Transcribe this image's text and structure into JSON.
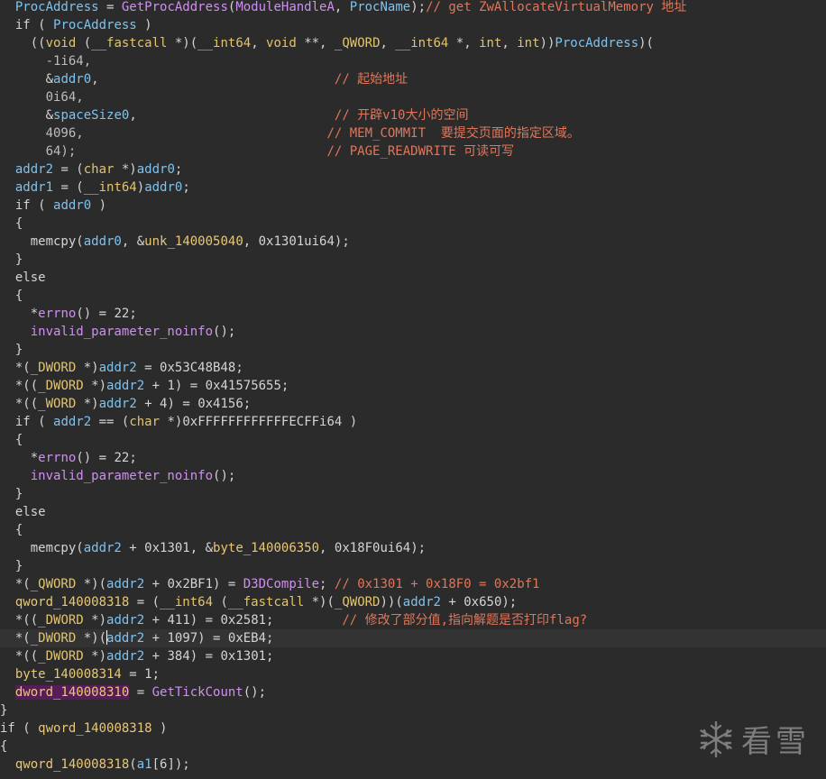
{
  "colors": {
    "background": "#2b2b2b",
    "identifier": "#7ec3ef",
    "function": "#cf8ff0",
    "type_keyword": "#e3c46b",
    "comment": "#e0765a",
    "text": "#d4d4d4"
  },
  "code": {
    "lines": [
      [
        [
          "  ",
          "t-pad"
        ],
        [
          "ProcAddress",
          "t-var"
        ],
        [
          " = ",
          "t-plain"
        ],
        [
          "GetProcAddress",
          "t-fn"
        ],
        [
          "(",
          "t-plain"
        ],
        [
          "ModuleHandleA",
          "t-fn"
        ],
        [
          ", ",
          "t-plain"
        ],
        [
          "ProcName",
          "t-var"
        ],
        [
          ");",
          "t-plain"
        ],
        [
          "// get ZwAllocateVirtualMemory 地址",
          "t-cm"
        ]
      ],
      [
        [
          "  if ( ",
          "t-plain"
        ],
        [
          "ProcAddress",
          "t-var"
        ],
        [
          " )",
          "t-plain"
        ]
      ],
      [
        [
          "    ((",
          "t-plain"
        ],
        [
          "void",
          "t-kw"
        ],
        [
          " (",
          "t-plain"
        ],
        [
          "__fastcall",
          "t-kw"
        ],
        [
          " *)(",
          "t-plain"
        ],
        [
          "__int64",
          "t-kw"
        ],
        [
          ", ",
          "t-plain"
        ],
        [
          "void",
          "t-kw"
        ],
        [
          " **, ",
          "t-plain"
        ],
        [
          "_QWORD",
          "t-kw"
        ],
        [
          ", ",
          "t-plain"
        ],
        [
          "__int64",
          "t-kw"
        ],
        [
          " *, ",
          "t-plain"
        ],
        [
          "int",
          "t-kw"
        ],
        [
          ", ",
          "t-plain"
        ],
        [
          "int",
          "t-kw"
        ],
        [
          "))",
          "t-plain"
        ],
        [
          "ProcAddress",
          "t-var"
        ],
        [
          ")(",
          "t-plain"
        ]
      ],
      [
        [
          "      -1i64,",
          "t-num"
        ]
      ],
      [
        [
          "      &",
          "t-plain"
        ],
        [
          "addr0",
          "t-var"
        ],
        [
          ",                               ",
          "t-plain"
        ],
        [
          "// 起始地址",
          "t-cm"
        ]
      ],
      [
        [
          "      0i64,",
          "t-num"
        ]
      ],
      [
        [
          "      &",
          "t-plain"
        ],
        [
          "spaceSize0",
          "t-var"
        ],
        [
          ",                          ",
          "t-plain"
        ],
        [
          "// 开辟v10大小的空间",
          "t-cm"
        ]
      ],
      [
        [
          "      4096,                                ",
          "t-num"
        ],
        [
          "// MEM_COMMIT  要提交页面的指定区域。",
          "t-cm"
        ]
      ],
      [
        [
          "      64);                                 ",
          "t-num"
        ],
        [
          "// PAGE_READWRITE 可读可写",
          "t-cm"
        ]
      ],
      [
        [
          "  ",
          "t-pad"
        ],
        [
          "addr2",
          "t-var"
        ],
        [
          " = (",
          "t-plain"
        ],
        [
          "char",
          "t-kw"
        ],
        [
          " *)",
          "t-plain"
        ],
        [
          "addr0",
          "t-var"
        ],
        [
          ";",
          "t-plain"
        ]
      ],
      [
        [
          "  ",
          "t-pad"
        ],
        [
          "addr1",
          "t-var"
        ],
        [
          " = (",
          "t-plain"
        ],
        [
          "__int64",
          "t-kw"
        ],
        [
          ")",
          "t-plain"
        ],
        [
          "addr0",
          "t-var"
        ],
        [
          ";",
          "t-plain"
        ]
      ],
      [
        [
          "  if ( ",
          "t-plain"
        ],
        [
          "addr0",
          "t-var"
        ],
        [
          " )",
          "t-plain"
        ]
      ],
      [
        [
          "  {",
          "t-plain"
        ]
      ],
      [
        [
          "    memcpy(",
          "t-plain"
        ],
        [
          "addr0",
          "t-var"
        ],
        [
          ", &",
          "t-plain"
        ],
        [
          "unk_140005040",
          "t-glob"
        ],
        [
          ", 0x1301ui64);",
          "t-plain"
        ]
      ],
      [
        [
          "  }",
          "t-plain"
        ]
      ],
      [
        [
          "  else",
          "t-plain"
        ]
      ],
      [
        [
          "  {",
          "t-plain"
        ]
      ],
      [
        [
          "    *",
          "t-plain"
        ],
        [
          "errno",
          "t-fn"
        ],
        [
          "() = 22;",
          "t-plain"
        ]
      ],
      [
        [
          "    ",
          "t-pad"
        ],
        [
          "invalid_parameter_noinfo",
          "t-fn"
        ],
        [
          "();",
          "t-plain"
        ]
      ],
      [
        [
          "  }",
          "t-plain"
        ]
      ],
      [
        [
          "  *(",
          "t-plain"
        ],
        [
          "_DWORD",
          "t-kw"
        ],
        [
          " *)",
          "t-plain"
        ],
        [
          "addr2",
          "t-var"
        ],
        [
          " = 0x53C48B48;",
          "t-plain"
        ]
      ],
      [
        [
          "  *((",
          "t-plain"
        ],
        [
          "_DWORD",
          "t-kw"
        ],
        [
          " *)",
          "t-plain"
        ],
        [
          "addr2",
          "t-var"
        ],
        [
          " + 1) = 0x41575655;",
          "t-plain"
        ]
      ],
      [
        [
          "  *((",
          "t-plain"
        ],
        [
          "_WORD",
          "t-kw"
        ],
        [
          " *)",
          "t-plain"
        ],
        [
          "addr2",
          "t-var"
        ],
        [
          " + 4) = 0x4156;",
          "t-plain"
        ]
      ],
      [
        [
          "  if ( ",
          "t-plain"
        ],
        [
          "addr2",
          "t-var"
        ],
        [
          " == (",
          "t-plain"
        ],
        [
          "char",
          "t-kw"
        ],
        [
          " *)0xFFFFFFFFFFFFECFFi64 )",
          "t-plain"
        ]
      ],
      [
        [
          "  {",
          "t-plain"
        ]
      ],
      [
        [
          "    *",
          "t-plain"
        ],
        [
          "errno",
          "t-fn"
        ],
        [
          "() = 22;",
          "t-plain"
        ]
      ],
      [
        [
          "    ",
          "t-pad"
        ],
        [
          "invalid_parameter_noinfo",
          "t-fn"
        ],
        [
          "();",
          "t-plain"
        ]
      ],
      [
        [
          "  }",
          "t-plain"
        ]
      ],
      [
        [
          "  else",
          "t-plain"
        ]
      ],
      [
        [
          "  {",
          "t-plain"
        ]
      ],
      [
        [
          "    memcpy(",
          "t-plain"
        ],
        [
          "addr2",
          "t-var"
        ],
        [
          " + 0x1301, &",
          "t-plain"
        ],
        [
          "byte_140006350",
          "t-glob"
        ],
        [
          ", 0x18F0ui64);",
          "t-plain"
        ]
      ],
      [
        [
          "  }",
          "t-plain"
        ]
      ],
      [
        [
          "  *(",
          "t-plain"
        ],
        [
          "_QWORD",
          "t-kw"
        ],
        [
          " *)(",
          "t-plain"
        ],
        [
          "addr2",
          "t-var"
        ],
        [
          " + 0x2BF1) = ",
          "t-plain"
        ],
        [
          "D3DCompile",
          "t-fn"
        ],
        [
          "; ",
          "t-plain"
        ],
        [
          "// 0x1301 + 0x18F0 = 0x2bf1",
          "t-cm"
        ]
      ],
      [
        [
          "  ",
          "t-pad"
        ],
        [
          "qword_140008318",
          "t-glob"
        ],
        [
          " = (",
          "t-plain"
        ],
        [
          "__int64",
          "t-kw"
        ],
        [
          " (",
          "t-plain"
        ],
        [
          "__fastcall",
          "t-kw"
        ],
        [
          " *)(",
          "t-plain"
        ],
        [
          "_QWORD",
          "t-kw"
        ],
        [
          "))(",
          "t-plain"
        ],
        [
          "addr2",
          "t-var"
        ],
        [
          " + 0x650);",
          "t-plain"
        ]
      ],
      [
        [
          "  *((",
          "t-plain"
        ],
        [
          "_DWORD",
          "t-kw"
        ],
        [
          " *)",
          "t-plain"
        ],
        [
          "addr2",
          "t-var"
        ],
        [
          " + 411) = 0x2581;         ",
          "t-plain"
        ],
        [
          "// 修改了部分值,指向解题是否打印flag?",
          "t-cm"
        ]
      ],
      [
        [
          "  *(",
          "t-plain"
        ],
        [
          "_DWORD",
          "t-kw"
        ],
        [
          " *)(",
          "t-plain"
        ],
        [
          "|",
          "caret"
        ],
        [
          "addr2",
          "t-var"
        ],
        [
          " + 1097) = 0xEB4;",
          "t-plain"
        ]
      ],
      [
        [
          "  *((",
          "t-plain"
        ],
        [
          "_DWORD",
          "t-kw"
        ],
        [
          " *)",
          "t-plain"
        ],
        [
          "addr2",
          "t-var"
        ],
        [
          " + 384) = 0x1301;",
          "t-plain"
        ]
      ],
      [
        [
          "  ",
          "t-pad"
        ],
        [
          "byte_140008314",
          "t-glob"
        ],
        [
          " = 1;",
          "t-plain"
        ]
      ],
      [
        [
          "  ",
          "t-pad"
        ],
        [
          "dword_140008310",
          "hl-purple t-glob"
        ],
        [
          " = ",
          "t-plain"
        ],
        [
          "GetTickCount",
          "t-fn"
        ],
        [
          "();",
          "t-plain"
        ]
      ],
      [
        [
          "}",
          "t-plain"
        ]
      ],
      [
        [
          "if ( ",
          "t-plain"
        ],
        [
          "qword_140008318",
          "t-glob"
        ],
        [
          " )",
          "t-plain"
        ]
      ],
      [
        [
          "{",
          "t-plain"
        ]
      ],
      [
        [
          "  ",
          "t-pad"
        ],
        [
          "qword_140008318",
          "t-glob"
        ],
        [
          "(",
          "t-plain"
        ],
        [
          "a1",
          "t-var"
        ],
        [
          "[6]);",
          "t-plain"
        ]
      ]
    ],
    "current_line": 35
  },
  "watermark": {
    "icon": "snowflake-icon",
    "text": "看雪"
  }
}
